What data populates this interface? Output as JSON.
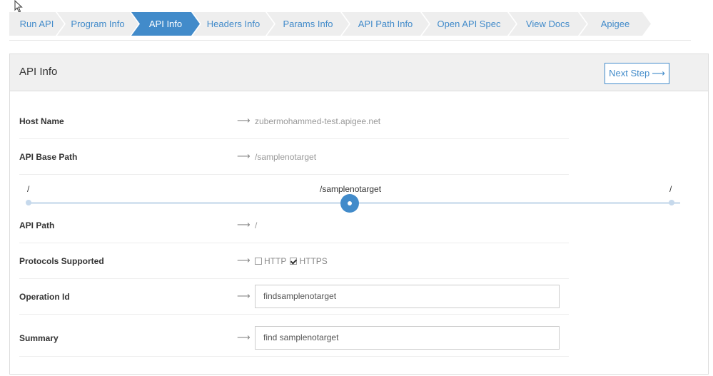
{
  "wizard": {
    "steps": [
      {
        "label": "Run API"
      },
      {
        "label": "Program Info"
      },
      {
        "label": "API Info"
      },
      {
        "label": "Headers Info"
      },
      {
        "label": "Params Info"
      },
      {
        "label": "API Path Info"
      },
      {
        "label": "Open API Spec"
      },
      {
        "label": "View Docs"
      },
      {
        "label": "Apigee"
      }
    ],
    "active_index": 2
  },
  "panel": {
    "title": "API Info",
    "next_label": "Next Step",
    "next_arrow": "⟶"
  },
  "form": {
    "arrow": "⟶",
    "host": {
      "label": "Host Name",
      "value": "zubermohammed-test.apigee.net"
    },
    "base_path": {
      "label": "API Base Path",
      "value": "/samplenotarget"
    },
    "slider": {
      "left": "/",
      "center": "/samplenotarget",
      "right": "/"
    },
    "api_path": {
      "label": "API Path",
      "value": "/"
    },
    "protocols": {
      "label": "Protocols Supported",
      "http": "HTTP",
      "https": "HTTPS",
      "http_checked": false,
      "https_checked": true
    },
    "operation_id": {
      "label": "Operation Id",
      "value": "findsamplenotarget"
    },
    "summary": {
      "label": "Summary",
      "value": "find samplenotarget"
    }
  },
  "colors": {
    "accent": "#428bca",
    "step_bg": "#eeeeee"
  }
}
